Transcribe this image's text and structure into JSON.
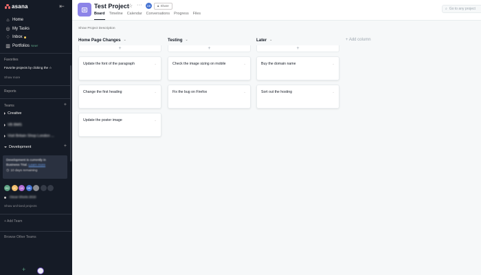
{
  "sidebar": {
    "logo_text": "asana",
    "nav": [
      {
        "label": "Home",
        "icon": "home-icon"
      },
      {
        "label": "My Tasks",
        "icon": "check-circle-icon"
      },
      {
        "label": "Inbox",
        "icon": "bell-icon"
      },
      {
        "label": "Portfolios",
        "icon": "bar-chart-icon",
        "badge": "New!"
      }
    ],
    "favorites_heading": "Favorites",
    "favorites_hint": "Favorite projects by clicking the ☆",
    "favorites_show_more": "Show more",
    "reports_heading": "Reports",
    "teams_heading": "Teams",
    "teams": [
      {
        "label": "Creative",
        "expanded": false
      },
      {
        "label": "VB BMS",
        "expanded": false
      },
      {
        "label": "Visit Britain Shop London ...",
        "expanded": false
      },
      {
        "label": "Development",
        "expanded": true
      }
    ],
    "trial": {
      "line1": "Development is currently in",
      "line2_prefix": "Business Trial.",
      "line2_link": "Learn more",
      "remaining": "10 days remaining"
    },
    "members": [
      {
        "initials": "DC",
        "color": "#5da283"
      },
      {
        "initials": "JC",
        "color": "#f1bd6c"
      },
      {
        "initials": "JA",
        "color": "#b36bd4"
      },
      {
        "initials": "DB",
        "color": "#4573d2"
      },
      {
        "initials": "",
        "color": "#8a8b90"
      }
    ],
    "show_archived": "Show archived projects",
    "archived_item": "Oscar Shorts 2019",
    "add_team": "Add Team",
    "browse_teams": "Browse Other Teams"
  },
  "header": {
    "title": "Test Project",
    "owner_initials": "DB",
    "share_label": "Share",
    "tabs": [
      "Board",
      "Timeline",
      "Calendar",
      "Conversations",
      "Progress",
      "Files"
    ],
    "active_tab": "Board",
    "search_placeholder": "Go to any project"
  },
  "board": {
    "description": "Show Project Description",
    "add_column": "+ Add column",
    "columns": [
      {
        "title": "Home Page Changes",
        "cards": [
          "Update the font of the paragraph",
          "Change the first heading",
          "Update the poster image"
        ]
      },
      {
        "title": "Testing",
        "cards": [
          "Check the image sizing on mobile",
          "Fix the bug on Firefox"
        ]
      },
      {
        "title": "Later",
        "cards": [
          "Buy the domain name",
          "Sort out the hosting"
        ]
      }
    ]
  },
  "colors": {
    "sidebar_bg": "#151b26",
    "project_icon": "#8d84e8",
    "accent_coral": "#f06a6a",
    "new_badge": "#5da283"
  }
}
